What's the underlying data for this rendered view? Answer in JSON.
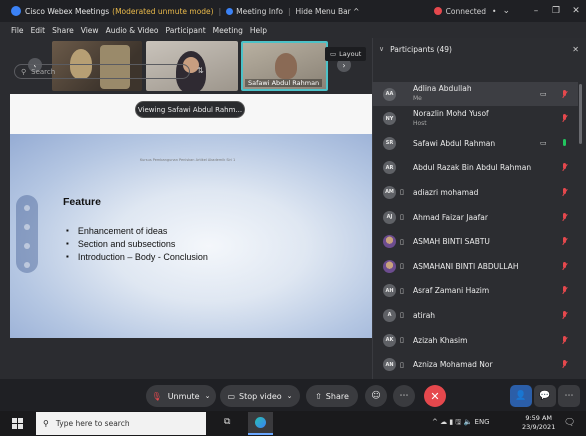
{
  "titlebar": {
    "app_name": "Cisco Webex Meetings",
    "mode": "(Moderated unmute mode)",
    "meeting_info": "Meeting Info",
    "hide_menu": "Hide Menu Bar ^",
    "status": "Connected",
    "status_bullet": "•",
    "chevron": "⌄",
    "minimize": "–",
    "restore": "❐",
    "close": "✕",
    "status_color": "#e5484d"
  },
  "menu": [
    "File",
    "Edit",
    "Share",
    "View",
    "Audio & Video",
    "Participant",
    "Meeting",
    "Help"
  ],
  "strip": {
    "prev": "‹",
    "next": "›",
    "active_thumb_name": "Safawi Abdul Rahman",
    "layout_label": "Layout"
  },
  "viewing_label": "Viewing Safawi Abdul Rahm...",
  "slide": {
    "header": "Kursus Pembangunan Peniskan Artikel Akademik Siri 1",
    "title": "Feature",
    "bullets": [
      "Enhancement of ideas",
      "Section and subsections",
      "Introduction – Body - Conclusion"
    ]
  },
  "panel": {
    "title": "Participants (49)",
    "search_placeholder": "Search",
    "participants": [
      {
        "initials": "AA",
        "name": "Adlina Abdullah",
        "sub": "Me",
        "phone": false,
        "cam": true,
        "mic": "muted",
        "photo": false
      },
      {
        "initials": "NY",
        "name": "Norazlin Mohd Yusof",
        "sub": "Host",
        "phone": false,
        "cam": false,
        "mic": "muted",
        "photo": false
      },
      {
        "initials": "SR",
        "name": "Safawi Abdul Rahman",
        "sub": "",
        "phone": false,
        "cam": true,
        "mic": "on",
        "photo": false
      },
      {
        "initials": "AR",
        "name": "Abdul Razak Bin Abdul Rahman",
        "sub": "",
        "phone": false,
        "cam": false,
        "mic": "muted",
        "photo": false
      },
      {
        "initials": "AM",
        "name": "adiazri mohamad",
        "sub": "",
        "phone": true,
        "cam": false,
        "mic": "muted",
        "photo": false
      },
      {
        "initials": "AJ",
        "name": "Ahmad Faizar Jaafar",
        "sub": "",
        "phone": true,
        "cam": false,
        "mic": "muted",
        "photo": false
      },
      {
        "initials": "",
        "name": "ASMAH BINTI SABTU",
        "sub": "",
        "phone": true,
        "cam": false,
        "mic": "muted",
        "photo": true
      },
      {
        "initials": "",
        "name": "ASMAHANI BINTI ABDULLAH",
        "sub": "",
        "phone": true,
        "cam": false,
        "mic": "muted",
        "photo": true
      },
      {
        "initials": "AH",
        "name": "Asraf Zamani Hazim",
        "sub": "",
        "phone": true,
        "cam": false,
        "mic": "muted",
        "photo": false
      },
      {
        "initials": "A",
        "name": "atirah",
        "sub": "",
        "phone": true,
        "cam": false,
        "mic": "muted",
        "photo": false
      },
      {
        "initials": "AK",
        "name": "Azizah Khasim",
        "sub": "",
        "phone": true,
        "cam": false,
        "mic": "muted",
        "photo": false
      },
      {
        "initials": "AN",
        "name": "Azniza Mohamad Nor",
        "sub": "",
        "phone": true,
        "cam": false,
        "mic": "muted",
        "photo": false
      }
    ]
  },
  "controls": {
    "unmute": "Unmute",
    "stop_video": "Stop video",
    "share": "Share",
    "end_color": "#e5484d"
  },
  "taskbar": {
    "search_placeholder": "Type here to search",
    "tray": "^ ☁ ▮ 🖫 🔈 ENG",
    "time": "9:59 AM",
    "date": "23/9/2021"
  }
}
